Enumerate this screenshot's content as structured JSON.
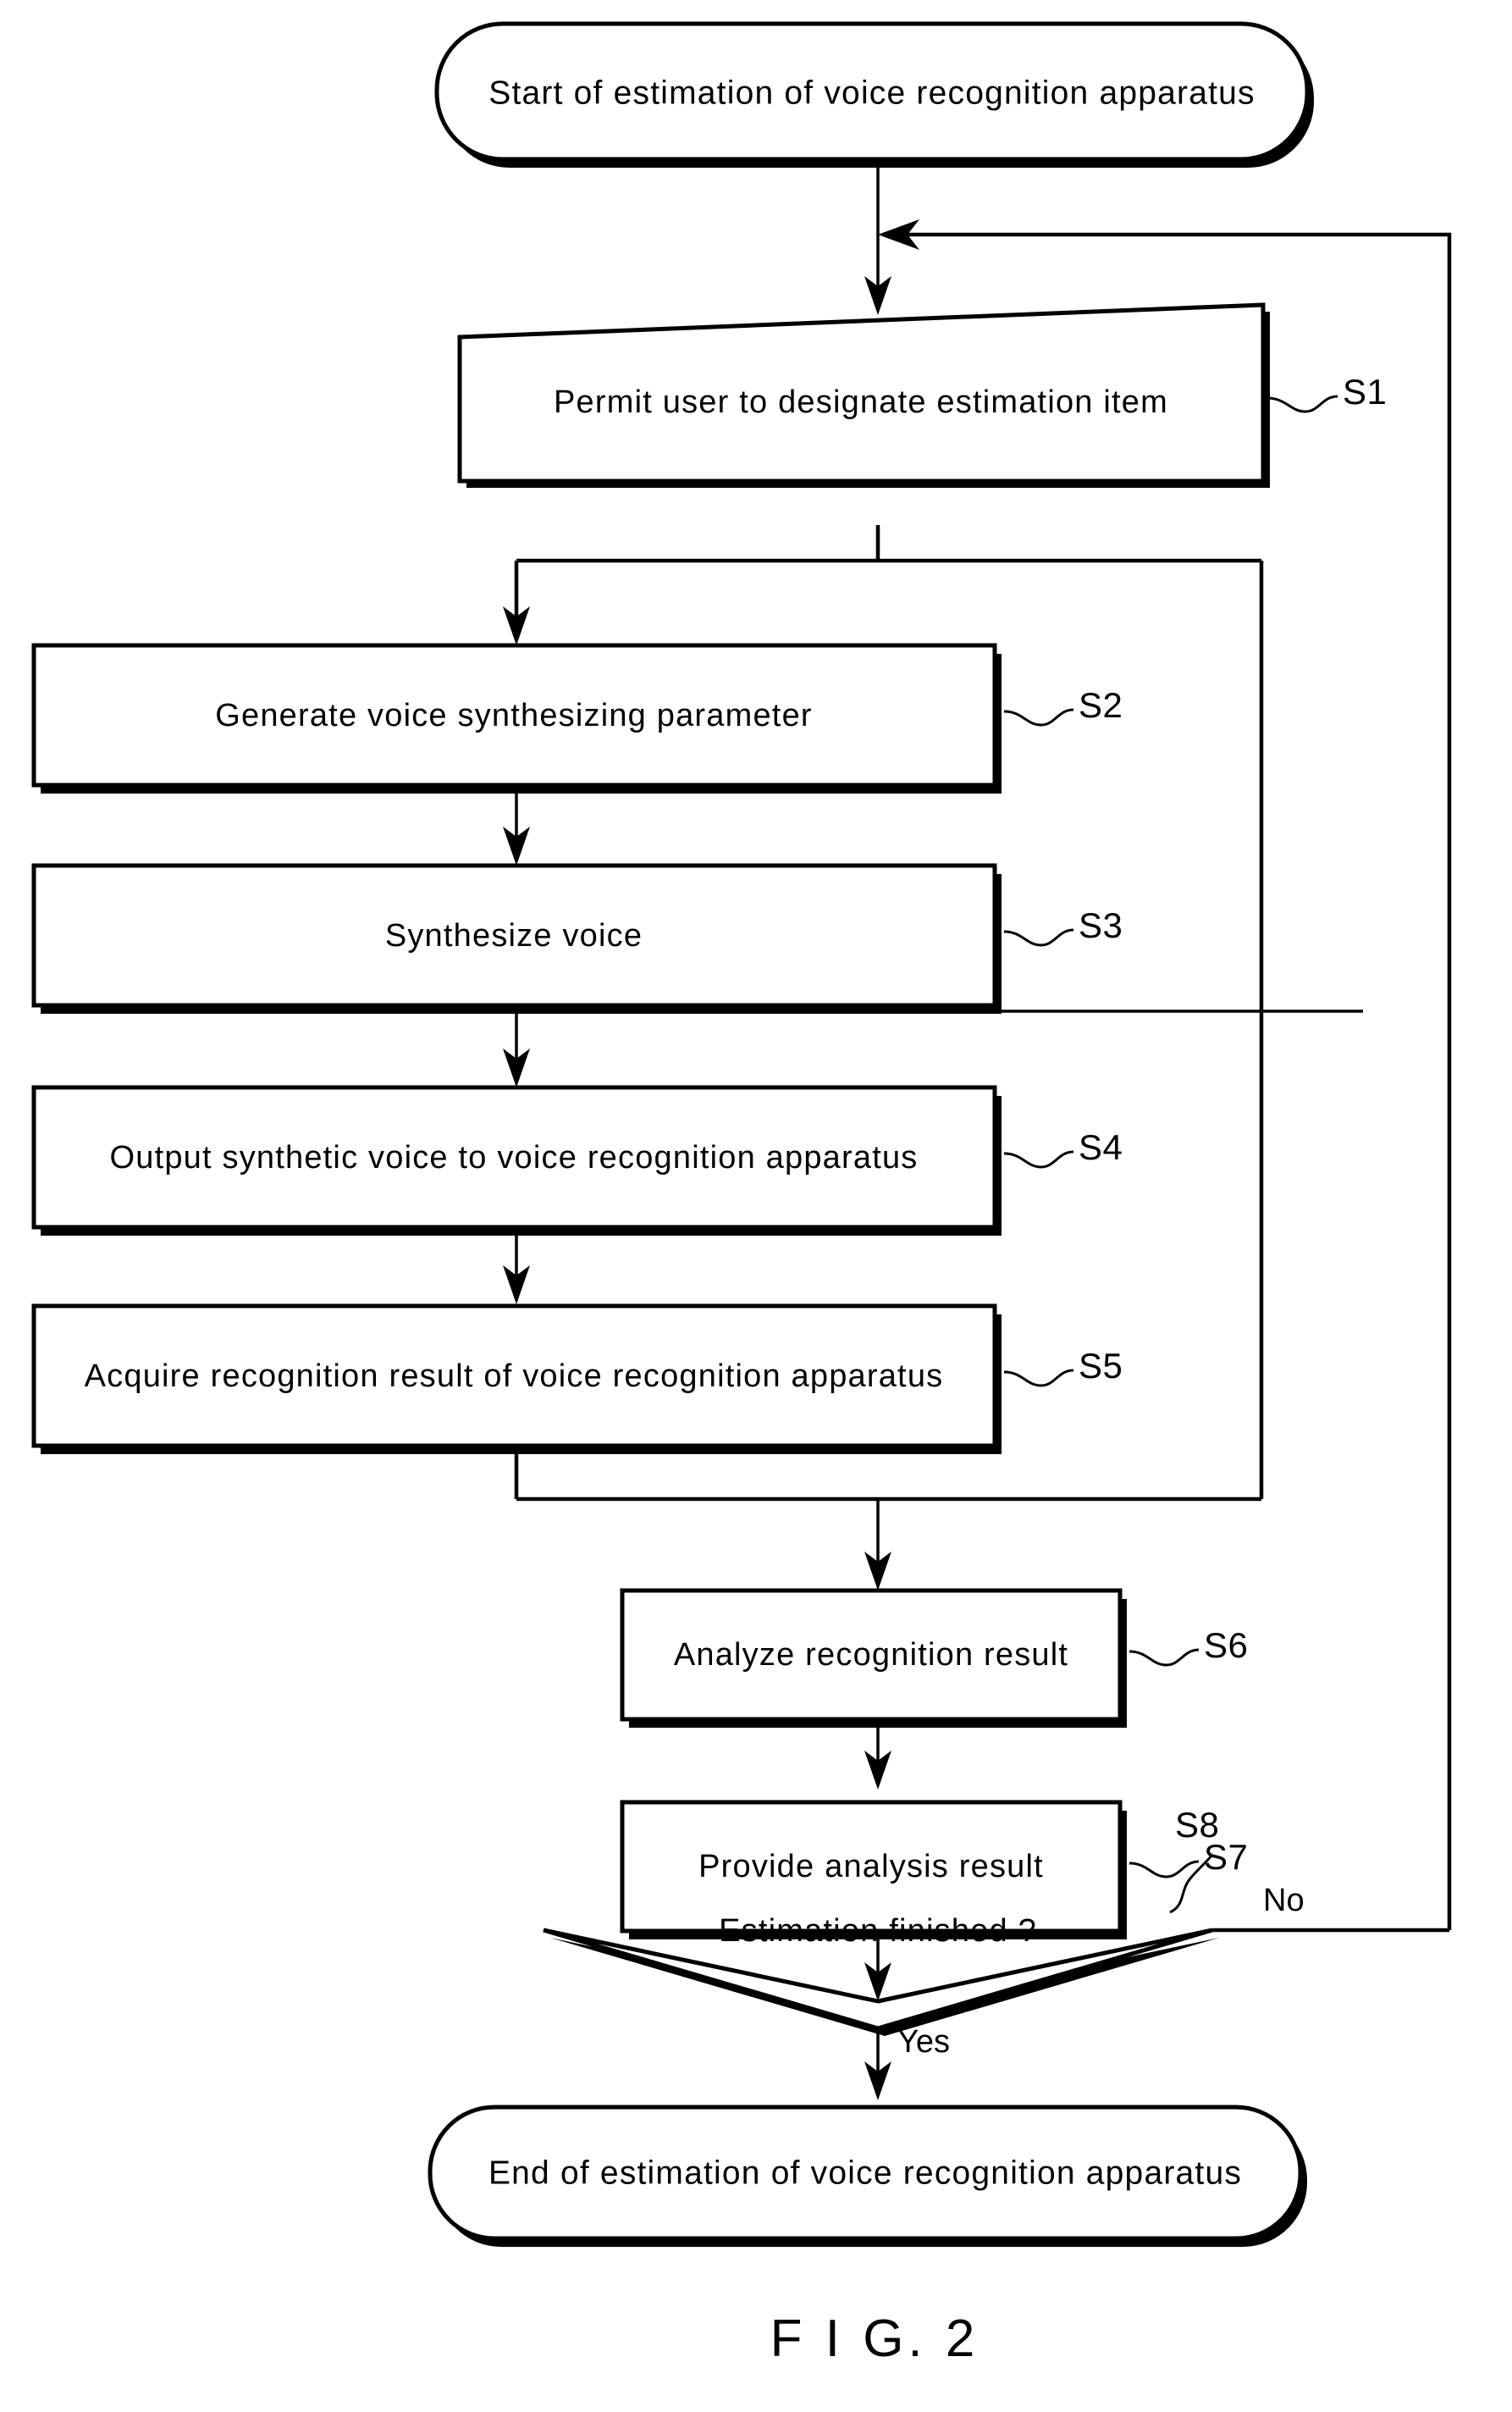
{
  "figure": {
    "caption": "F I G. 2"
  },
  "nodes": {
    "start": {
      "type": "terminator",
      "text": "Start of estimation of voice recognition apparatus"
    },
    "s1": {
      "type": "trapezoid",
      "text": "Permit user to designate estimation item",
      "step": "S1"
    },
    "s2": {
      "type": "process",
      "text": "Generate voice synthesizing parameter",
      "step": "S2"
    },
    "s3": {
      "type": "process",
      "text": "Synthesize voice",
      "step": "S3"
    },
    "s4": {
      "type": "process",
      "text": "Output synthetic voice to voice recognition apparatus",
      "step": "S4"
    },
    "s5": {
      "type": "process",
      "text": "Acquire recognition result of voice recognition apparatus",
      "step": "S5"
    },
    "s6": {
      "type": "process",
      "text": "Analyze recognition result",
      "step": "S6"
    },
    "s7": {
      "type": "process",
      "text": "Provide analysis result",
      "step": "S7"
    },
    "s8": {
      "type": "decision",
      "text": "Estimation finished ?",
      "step": "S8"
    },
    "end": {
      "type": "terminator",
      "text": "End of estimation of voice recognition apparatus"
    }
  },
  "branches": {
    "no_label": "No",
    "yes_label": "Yes"
  },
  "colors": {
    "stroke": "#000000",
    "fill": "#ffffff",
    "text": "#000000"
  }
}
